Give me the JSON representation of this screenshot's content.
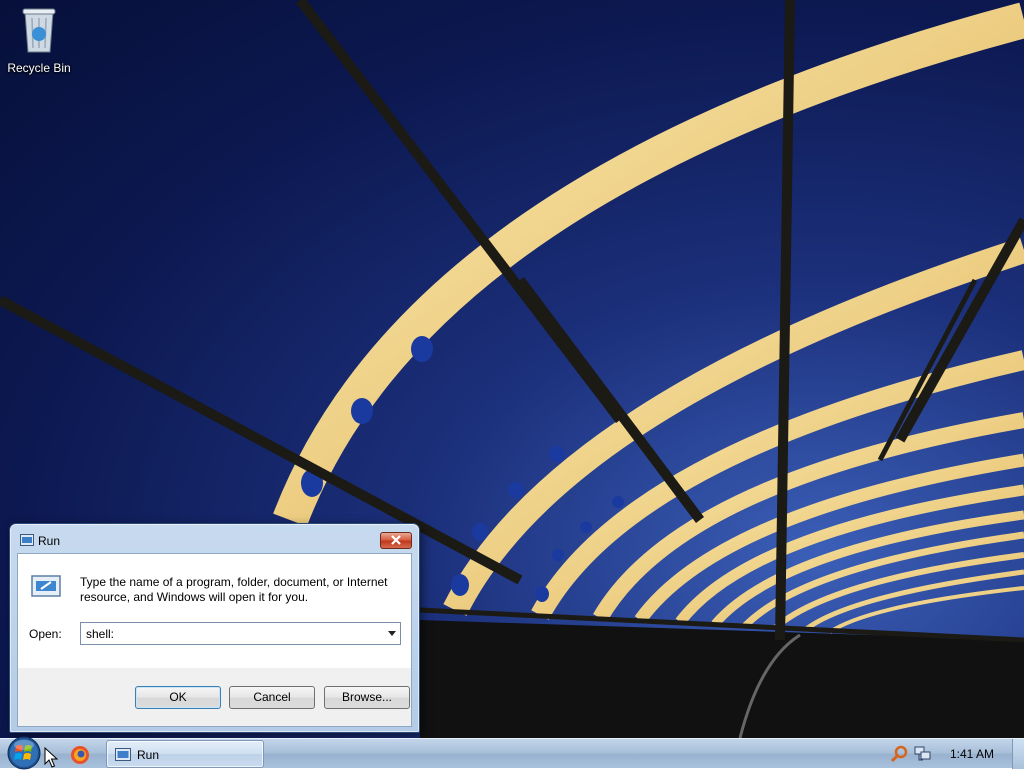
{
  "desktop": {
    "icons": [
      {
        "label": "Recycle Bin",
        "icon": "recycle-bin-icon"
      }
    ]
  },
  "run_dialog": {
    "title": "Run",
    "description": "Type the name of a program, folder, document, or Internet resource, and Windows will open it for you.",
    "open_label": "Open:",
    "open_value": "shell:",
    "buttons": {
      "ok": "OK",
      "cancel": "Cancel",
      "browse": "Browse..."
    }
  },
  "taskbar": {
    "pinned": [
      {
        "icon": "firefox-icon"
      }
    ],
    "tasks": [
      {
        "label": "Run",
        "icon": "run-icon"
      }
    ],
    "tray": {
      "icons": [
        "search-icon",
        "network-icon"
      ],
      "clock": "1:41 AM"
    }
  },
  "colors": {
    "close_button": "#c0351b",
    "taskbar": "#a9c1dc",
    "sky_top": "#07103a",
    "sky_horizon": "#3b5fb8",
    "bridge_glow": "#f5d776"
  }
}
